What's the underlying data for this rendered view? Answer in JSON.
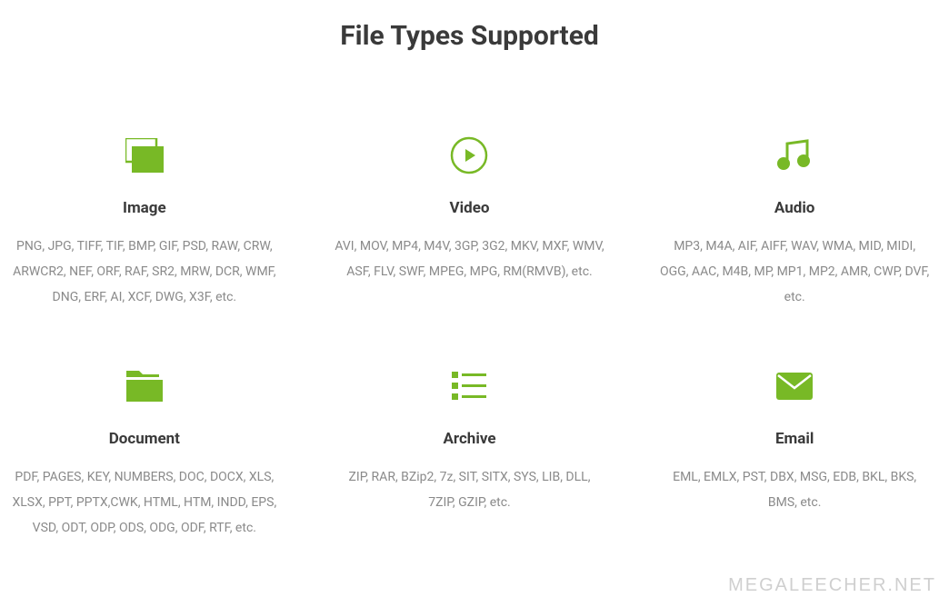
{
  "title": "File Types Supported",
  "watermark": "MEGALEECHER.NET",
  "icon_color": "#78b926",
  "cards": [
    {
      "icon": "image-icon",
      "title": "Image",
      "description": "PNG, JPG, TIFF, TIF, BMP, GIF, PSD, RAW, CRW, ARWCR2, NEF, ORF, RAF, SR2, MRW, DCR, WMF, DNG, ERF, AI, XCF, DWG, X3F, etc."
    },
    {
      "icon": "video-icon",
      "title": "Video",
      "description": "AVI, MOV, MP4, M4V, 3GP, 3G2, MKV, MXF, WMV, ASF, FLV, SWF, MPEG, MPG, RM(RMVB), etc."
    },
    {
      "icon": "audio-icon",
      "title": "Audio",
      "description": "MP3, M4A, AIF, AIFF, WAV, WMA, MID, MIDI, OGG, AAC, M4B, MP, MP1, MP2, AMR, CWP, DVF, etc."
    },
    {
      "icon": "document-icon",
      "title": "Document",
      "description": "PDF, PAGES, KEY, NUMBERS, DOC, DOCX, XLS, XLSX, PPT, PPTX,CWK, HTML, HTM, INDD, EPS, VSD, ODT, ODP, ODS, ODG, ODF, RTF, etc."
    },
    {
      "icon": "archive-icon",
      "title": "Archive",
      "description": "ZIP, RAR, BZip2, 7z, SIT, SITX, SYS, LIB, DLL, 7ZIP, GZIP, etc."
    },
    {
      "icon": "email-icon",
      "title": "Email",
      "description": "EML, EMLX, PST, DBX, MSG, EDB, BKL, BKS, BMS, etc."
    }
  ]
}
